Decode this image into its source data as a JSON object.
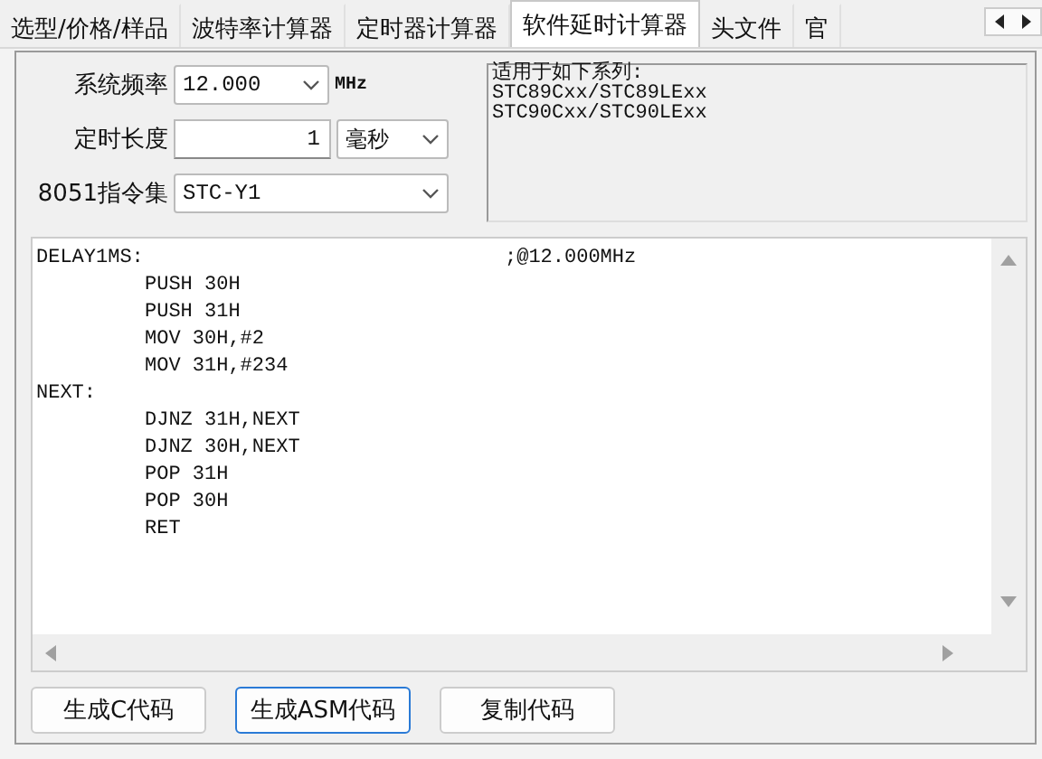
{
  "tabs": [
    {
      "label": "选型/价格/样品",
      "selected": false
    },
    {
      "label": "波特率计算器",
      "selected": false
    },
    {
      "label": "定时器计算器",
      "selected": false
    },
    {
      "label": "软件延时计算器",
      "selected": true
    },
    {
      "label": "头文件",
      "selected": false
    },
    {
      "label": "官",
      "selected": false
    }
  ],
  "settings": {
    "frequency": {
      "label": "系统频率",
      "value": "12.000",
      "unit": "MHz"
    },
    "duration": {
      "label": "定时长度",
      "value": "1",
      "unit": "毫秒"
    },
    "instruction_set": {
      "label": "8051指令集",
      "value": "STC-Y1"
    }
  },
  "applicable_series": [
    "适用于如下系列:",
    "STC89Cxx/STC89LExx",
    "STC90Cxx/STC90LExx"
  ],
  "code": [
    {
      "text": "DELAY1MS:",
      "indented": false,
      "comment": ";@12.000MHz"
    },
    {
      "text": "PUSH 30H",
      "indented": true
    },
    {
      "text": "PUSH 31H",
      "indented": true
    },
    {
      "text": "MOV 30H,#2",
      "indented": true
    },
    {
      "text": "MOV 31H,#234",
      "indented": true
    },
    {
      "text": "NEXT:",
      "indented": false
    },
    {
      "text": "DJNZ 31H,NEXT",
      "indented": true
    },
    {
      "text": "DJNZ 30H,NEXT",
      "indented": true
    },
    {
      "text": "POP 31H",
      "indented": true
    },
    {
      "text": "POP 30H",
      "indented": true
    },
    {
      "text": "RET",
      "indented": true
    }
  ],
  "buttons": [
    {
      "label": "生成C代码",
      "selected": false
    },
    {
      "label": "生成ASM代码",
      "selected": true
    },
    {
      "label": "复制代码",
      "selected": false
    }
  ]
}
